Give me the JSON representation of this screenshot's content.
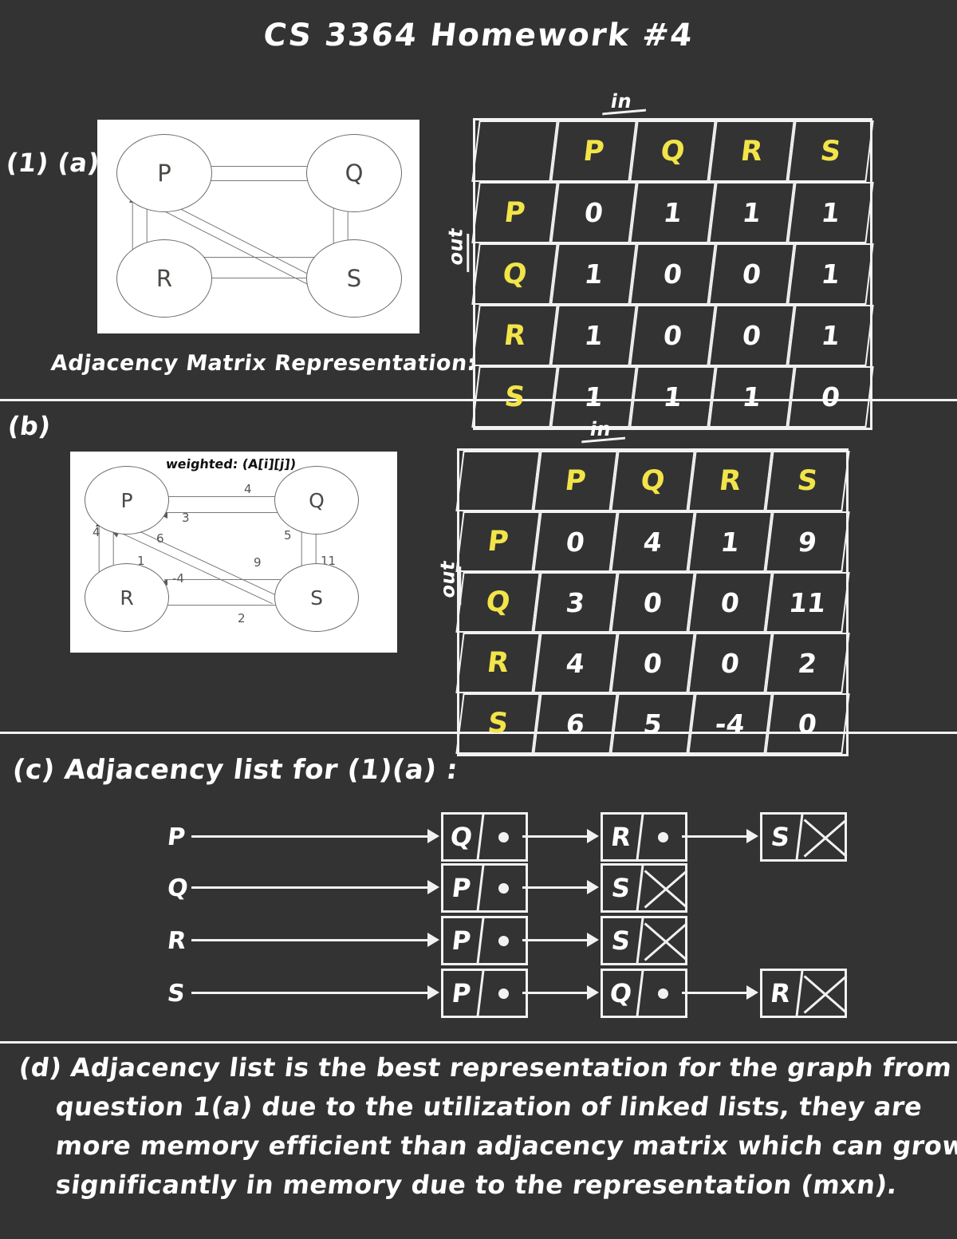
{
  "title": "CS 3364  Homework #4",
  "sections": {
    "q1a_label": "(1) (a)",
    "b_label": "(b)",
    "c_label": "(c)  Adjacency list for (1)(a) :",
    "adjacency_caption": "Adjacency Matrix Representation:"
  },
  "graph_a": {
    "nodes": [
      "P",
      "Q",
      "R",
      "S"
    ]
  },
  "graph_b": {
    "note": "weighted: (A[i][j])",
    "nodes": [
      "P",
      "Q",
      "R",
      "S"
    ],
    "edge_weights": [
      "4",
      "3",
      "4",
      "6",
      "1",
      "5",
      "9",
      "11",
      "-4",
      "2"
    ]
  },
  "matrix_a": {
    "axis_in": "in",
    "axis_out": "out",
    "col_headers": [
      "P",
      "Q",
      "R",
      "S"
    ],
    "row_headers": [
      "P",
      "Q",
      "R",
      "S"
    ],
    "rows": [
      [
        "0",
        "1",
        "1",
        "1"
      ],
      [
        "1",
        "0",
        "0",
        "1"
      ],
      [
        "1",
        "0",
        "0",
        "1"
      ],
      [
        "1",
        "1",
        "1",
        "0"
      ]
    ]
  },
  "matrix_b": {
    "axis_in": "in",
    "axis_out": "out",
    "col_headers": [
      "P",
      "Q",
      "R",
      "S"
    ],
    "row_headers": [
      "P",
      "Q",
      "R",
      "S"
    ],
    "rows": [
      [
        "0",
        "4",
        "1",
        "9"
      ],
      [
        "3",
        "0",
        "0",
        "11"
      ],
      [
        "4",
        "0",
        "0",
        "2"
      ],
      [
        "6",
        "5",
        "-4",
        "0"
      ]
    ]
  },
  "adjacency_list": {
    "rows": [
      {
        "source": "P",
        "nodes": [
          "Q",
          "R",
          "S"
        ]
      },
      {
        "source": "Q",
        "nodes": [
          "P",
          "S"
        ]
      },
      {
        "source": "R",
        "nodes": [
          "P",
          "S"
        ]
      },
      {
        "source": "S",
        "nodes": [
          "P",
          "Q",
          "R"
        ]
      }
    ]
  },
  "part_d": {
    "lines": [
      "(d) Adjacency list is the best representation for the graph from",
      "question 1(a) due to the utilization of linked lists, they are",
      "more memory efficient than adjacency matrix which can grow",
      "significantly in memory due to the representation (mxn)."
    ]
  },
  "colors": {
    "background": "#333333",
    "ink": "#ffffff",
    "header_yellow": "#f2e449",
    "figure_background": "#ffffff",
    "figure_stroke": "#6b6b6b"
  }
}
